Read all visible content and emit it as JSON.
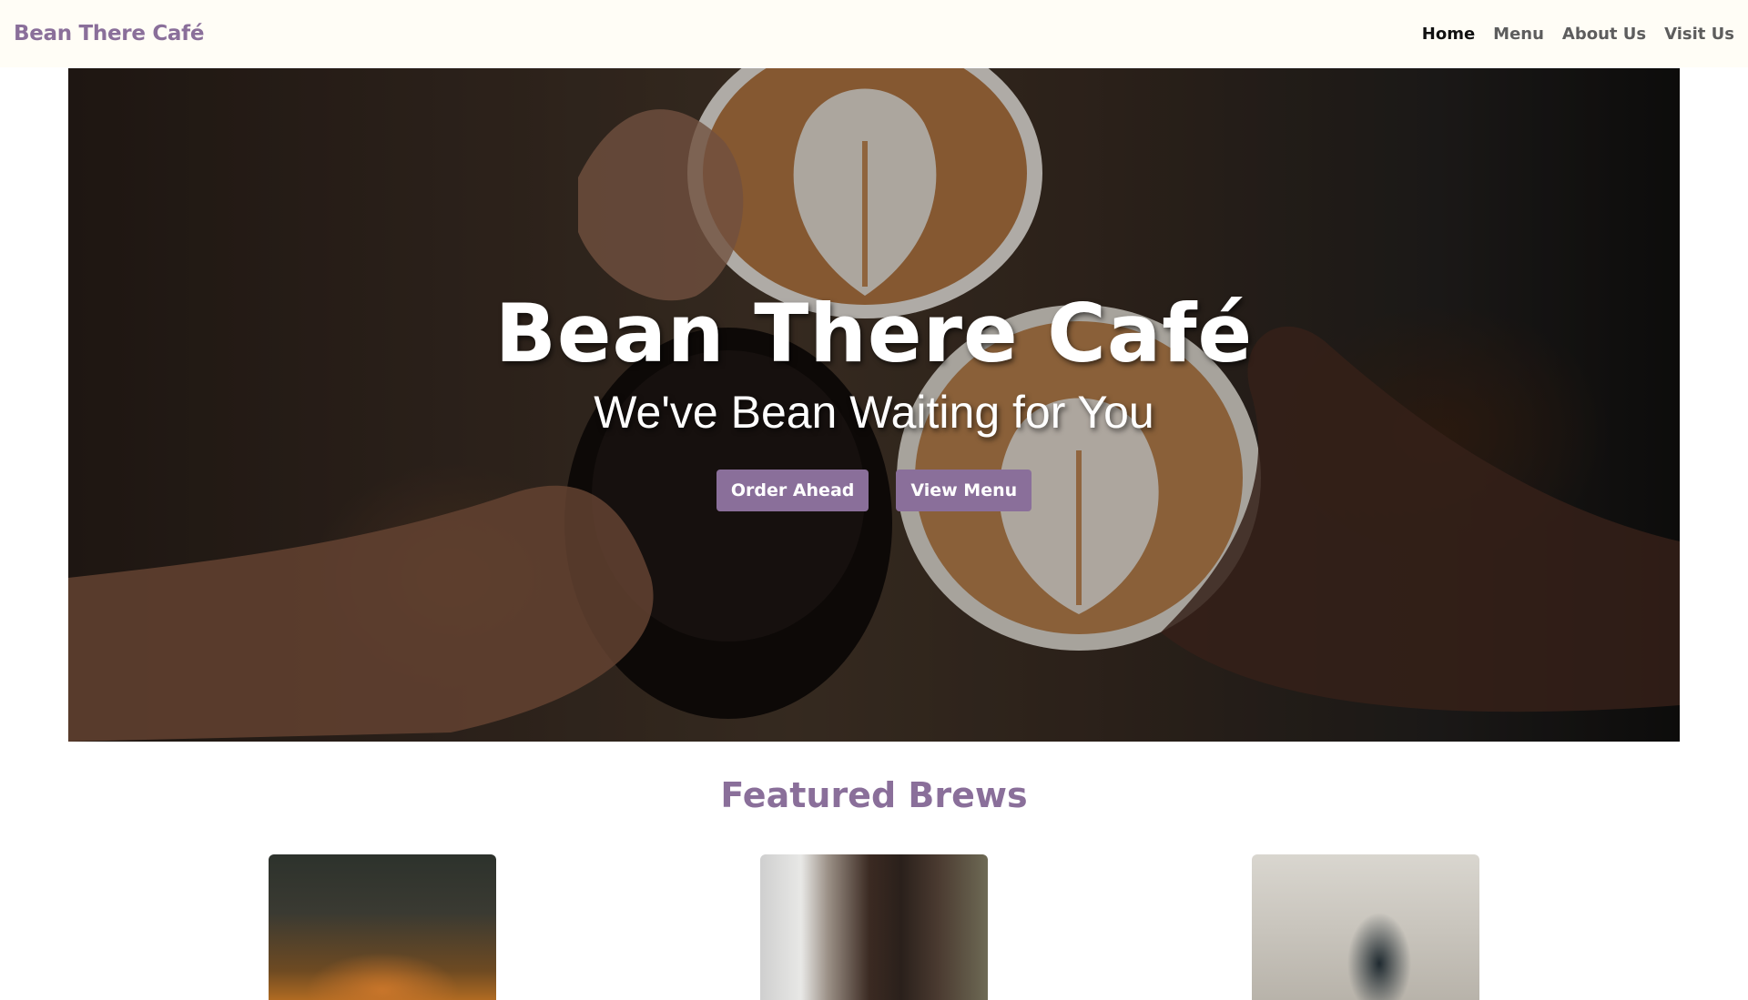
{
  "navbar": {
    "brand": "Bean There Café",
    "links": [
      {
        "label": "Home",
        "active": true
      },
      {
        "label": "Menu",
        "active": false
      },
      {
        "label": "About Us",
        "active": false
      },
      {
        "label": "Visit Us",
        "active": false
      }
    ]
  },
  "hero": {
    "title": "Bean There Café",
    "subtitle": "We've Bean Waiting for You",
    "buttons": {
      "order": "Order Ahead",
      "menu": "View Menu"
    }
  },
  "featured": {
    "title": "Featured Brews"
  },
  "colors": {
    "accent": "#8a6f9a",
    "navbar_bg": "#fffdf6",
    "active_link": "#111111",
    "link": "#5d5d5d"
  }
}
